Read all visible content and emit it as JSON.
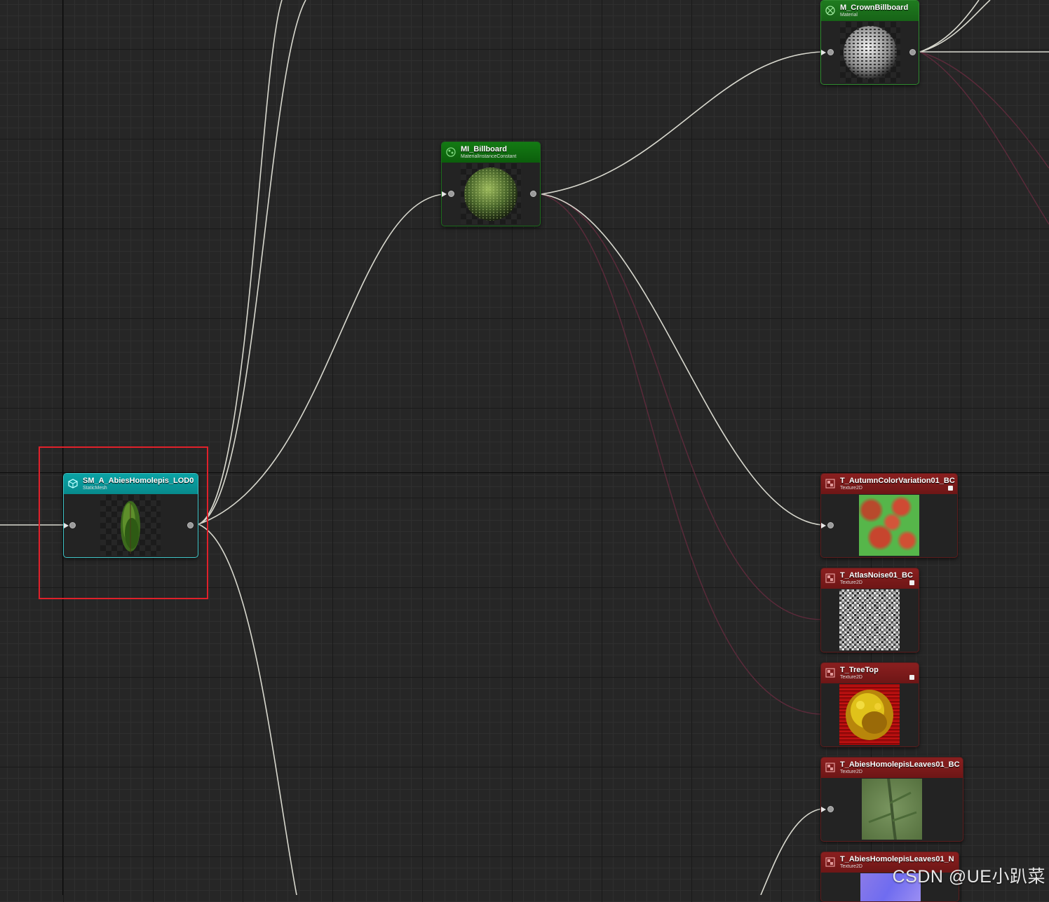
{
  "graph": {
    "nodes": [
      {
        "id": "mesh",
        "title": "SM_A_AbiesHomolepis_LOD0",
        "subtitle": "StaticMesh",
        "kind": "static-mesh"
      },
      {
        "id": "mi",
        "title": "MI_Billboard",
        "subtitle": "MaterialInstanceConstant",
        "kind": "material-instance"
      },
      {
        "id": "mat",
        "title": "M_CrownBillboard",
        "subtitle": "Material",
        "kind": "material"
      },
      {
        "id": "tex1",
        "title": "T_AutumnColorVariation01_BC",
        "subtitle": "Texture2D",
        "kind": "texture"
      },
      {
        "id": "tex2",
        "title": "T_AtlasNoise01_BC",
        "subtitle": "Texture2D",
        "kind": "texture"
      },
      {
        "id": "tex3",
        "title": "T_TreeTop",
        "subtitle": "Texture2D",
        "kind": "texture"
      },
      {
        "id": "tex4",
        "title": "T_AbiesHomolepisLeaves01_BC",
        "subtitle": "Texture2D",
        "kind": "texture"
      },
      {
        "id": "tex5",
        "title": "T_AbiesHomolepisLeaves01_N",
        "subtitle": "Texture2D",
        "kind": "texture"
      }
    ],
    "icons": {
      "static-mesh": "static-mesh-icon",
      "material-instance": "material-instance-icon",
      "material": "material-icon",
      "texture": "texture-icon"
    },
    "colors": {
      "background": "#262626",
      "wire": "#d9d9cf",
      "soft_wire": "#5a2a3a",
      "selection": "#e0202a",
      "mesh_header": "#0ba3a5",
      "material_header": "#137a13",
      "texture_header": "#8a1f1f"
    }
  },
  "watermark": "CSDN @UE小趴菜"
}
